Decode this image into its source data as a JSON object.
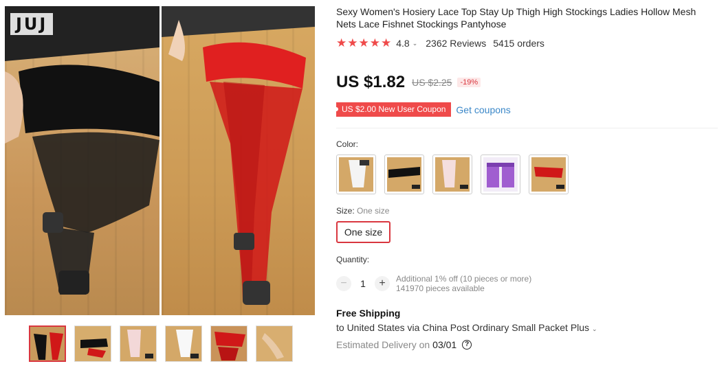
{
  "gallery": {
    "logo_text": "JUJ",
    "thumbnail_count": 6,
    "active_thumbnail": 1
  },
  "product": {
    "title": "Sexy Women's Hosiery Lace Top Stay Up Thigh High Stockings Ladies Hollow Mesh Nets Lace Fishnet Stockings Pantyhose",
    "rating": "4.8",
    "rating_stars": 5,
    "reviews": "2362 Reviews",
    "orders": "5415 orders"
  },
  "pricing": {
    "price": "US $1.82",
    "original_price": "US $2.25",
    "discount": "-19%",
    "coupon": "US $2.00 New User Coupon",
    "get_coupons": "Get coupons"
  },
  "options": {
    "color_label": "Color:",
    "size_label": "Size:",
    "size_selected": "One size",
    "size_option": "One size"
  },
  "quantity": {
    "label": "Quantity:",
    "minus": "−",
    "value": "1",
    "plus": "+",
    "additional_off": "Additional 1% off (10 pieces or more)",
    "available": "141970 pieces available"
  },
  "shipping": {
    "title": "Free Shipping",
    "destination": "to United States via China Post Ordinary Small Packet Plus",
    "estimated_label": "Estimated Delivery on",
    "estimated_date": "03/01",
    "help_icon": "?"
  },
  "colors": {
    "accent": "#ef4a4a",
    "link": "#3a87c8",
    "selected_border": "#d9363e"
  }
}
